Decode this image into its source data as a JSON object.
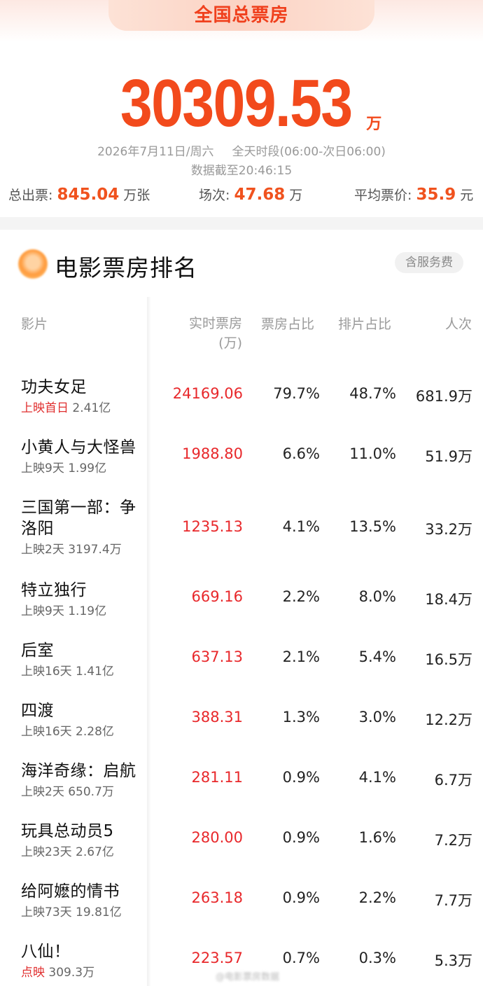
{
  "header": {
    "tab_label": "全国总票房",
    "total_value": "30309.53",
    "total_unit": "万",
    "date": "2026年7月11日/周六",
    "period": "全天时段(06:00-次日06:00)",
    "cutoff": "数据截至20:46:15"
  },
  "stats": {
    "tickets_label": "总出票:",
    "tickets_value": "845.04",
    "tickets_unit": "万张",
    "shows_label": "场次:",
    "shows_value": "47.68",
    "shows_unit": "万",
    "avg_label": "平均票价:",
    "avg_value": "35.9",
    "avg_unit": "元"
  },
  "section": {
    "title": "电影票房排名",
    "service_badge": "含服务费"
  },
  "columns": {
    "film": "影片",
    "box_line1": "实时票房",
    "box_line2": "(万)",
    "box_share": "票房占比",
    "show_share": "排片占比",
    "people": "人次"
  },
  "films": [
    {
      "name": "功夫女足",
      "tag": "上映首日",
      "info": "2.41亿",
      "box": "24169.06",
      "box_share": "79.7%",
      "show_share": "48.7%",
      "people": "681.9万"
    },
    {
      "name": "小黄人与大怪兽",
      "tag": "",
      "info": "上映9天 1.99亿",
      "box": "1988.80",
      "box_share": "6.6%",
      "show_share": "11.0%",
      "people": "51.9万"
    },
    {
      "name": "三国第一部：争洛阳",
      "tag": "",
      "info": "上映2天 3197.4万",
      "box": "1235.13",
      "box_share": "4.1%",
      "show_share": "13.5%",
      "people": "33.2万"
    },
    {
      "name": "特立独行",
      "tag": "",
      "info": "上映9天 1.19亿",
      "box": "669.16",
      "box_share": "2.2%",
      "show_share": "8.0%",
      "people": "18.4万"
    },
    {
      "name": "后室",
      "tag": "",
      "info": "上映16天 1.41亿",
      "box": "637.13",
      "box_share": "2.1%",
      "show_share": "5.4%",
      "people": "16.5万"
    },
    {
      "name": "四渡",
      "tag": "",
      "info": "上映16天 2.28亿",
      "box": "388.31",
      "box_share": "1.3%",
      "show_share": "3.0%",
      "people": "12.2万"
    },
    {
      "name": "海洋奇缘：启航",
      "tag": "",
      "info": "上映2天 650.7万",
      "box": "281.11",
      "box_share": "0.9%",
      "show_share": "4.1%",
      "people": "6.7万"
    },
    {
      "name": "玩具总动员5",
      "tag": "",
      "info": "上映23天 2.67亿",
      "box": "280.00",
      "box_share": "0.9%",
      "show_share": "1.6%",
      "people": "7.2万"
    },
    {
      "name": "给阿嬷的情书",
      "tag": "",
      "info": "上映73天 19.81亿",
      "box": "263.18",
      "box_share": "0.9%",
      "show_share": "2.2%",
      "people": "7.7万"
    },
    {
      "name": "八仙！",
      "tag": "点映",
      "info": "309.3万",
      "box": "223.57",
      "box_share": "0.7%",
      "show_share": "0.3%",
      "people": "5.3万"
    }
  ],
  "footer": {
    "watermark": "@电影票房数据"
  },
  "colors": {
    "accent": "#f24a1c",
    "box_value": "#e8282b"
  }
}
